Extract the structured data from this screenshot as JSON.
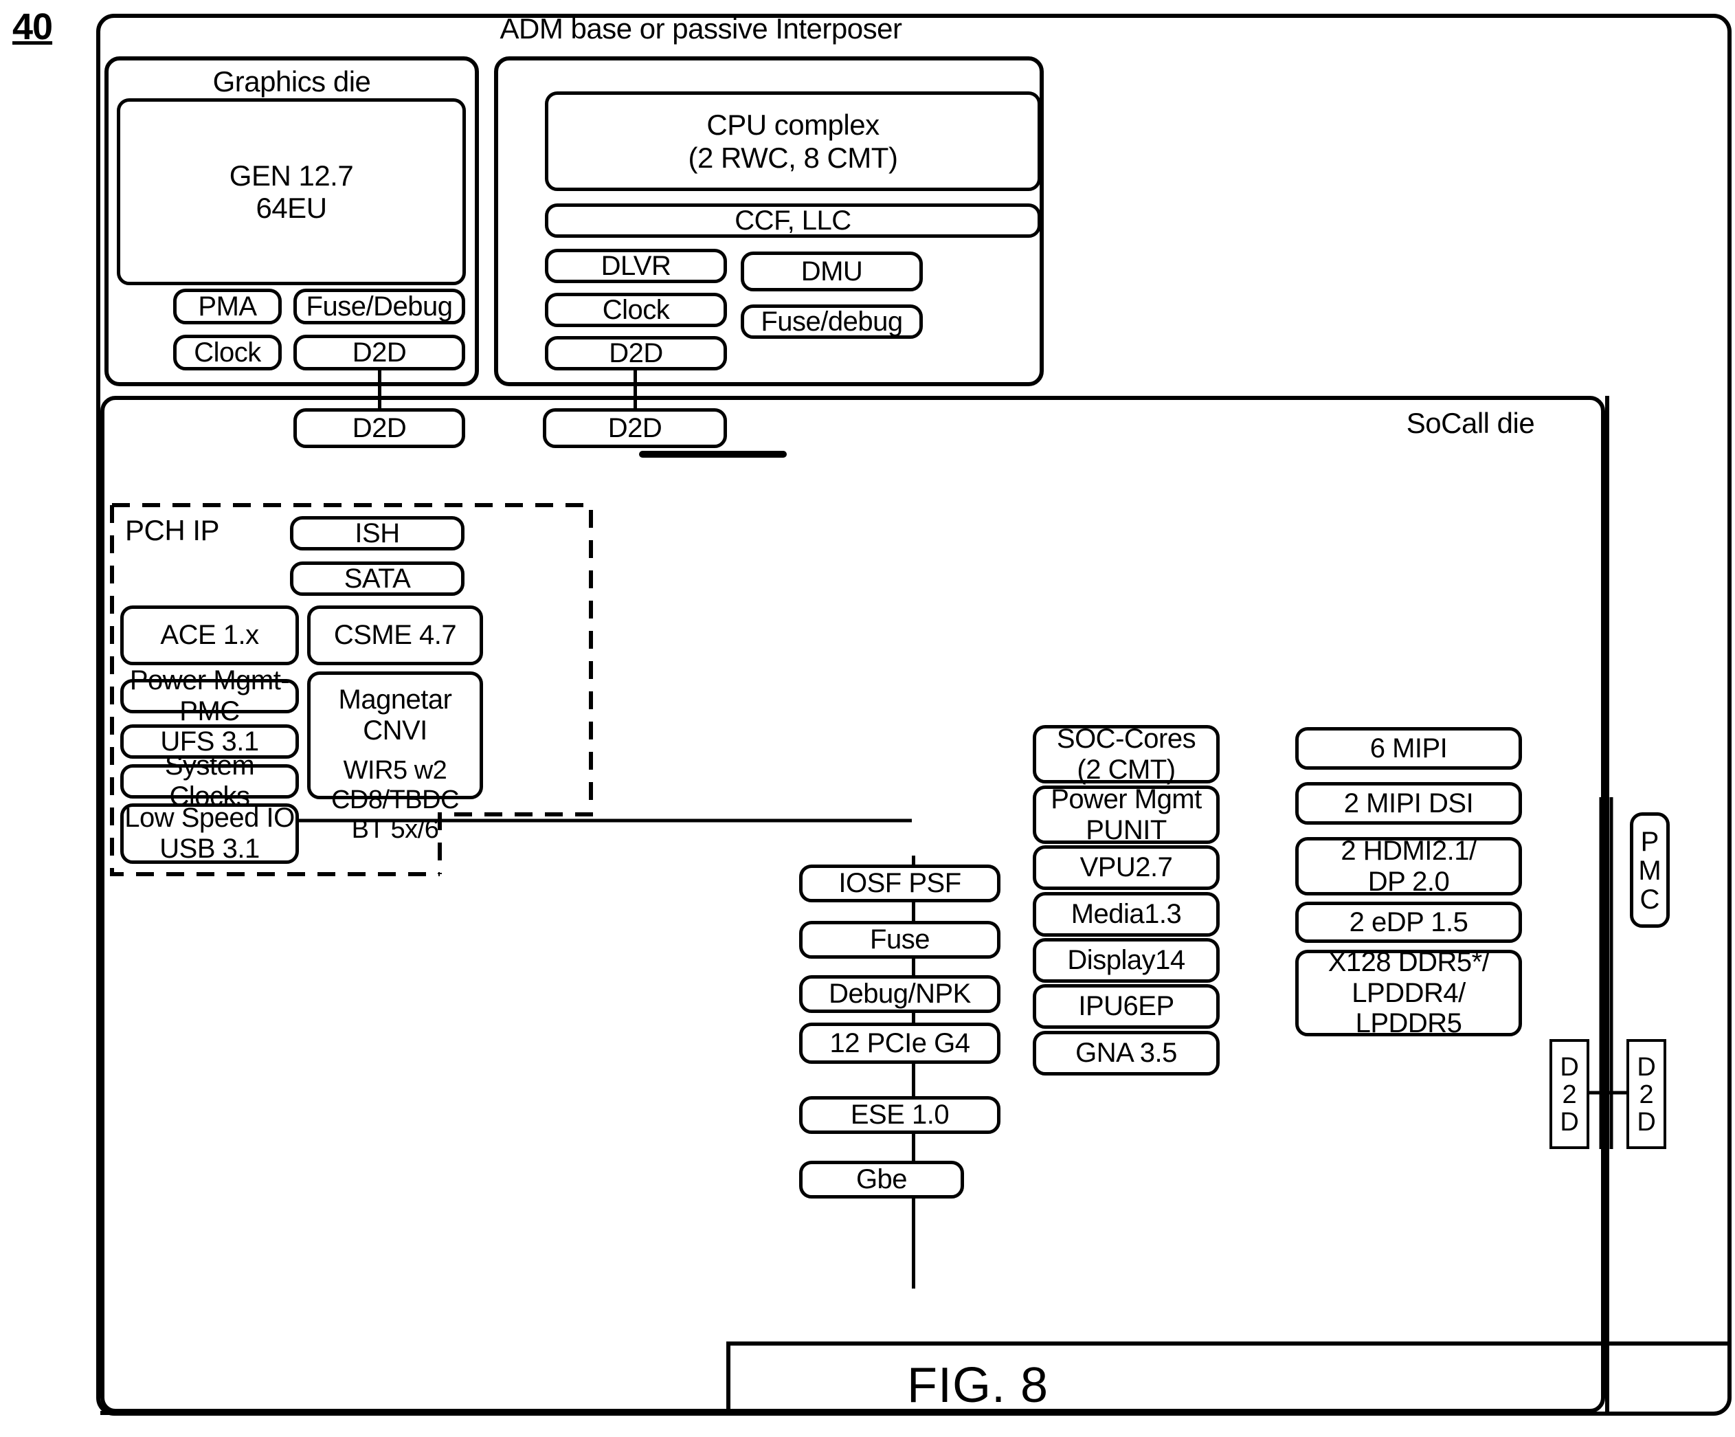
{
  "figure": {
    "reference_numeral": "40",
    "caption": "FIG. 8"
  },
  "interposer": {
    "label": "ADM base or passive Interposer"
  },
  "graphics_die": {
    "label": "Graphics die",
    "main_block": "GEN 12.7\n64EU",
    "blocks": [
      {
        "label": "PMA"
      },
      {
        "label": "Fuse/Debug"
      },
      {
        "label": "Clock"
      },
      {
        "label": "D2D"
      }
    ]
  },
  "cpu_die": {
    "blocks": [
      {
        "label": "CPU complex\n(2 RWC, 8 CMT)"
      },
      {
        "label": "CCF, LLC"
      },
      {
        "label": "DLVR"
      },
      {
        "label": "DMU"
      },
      {
        "label": "Clock"
      },
      {
        "label": "Fuse/debug"
      },
      {
        "label": "D2D"
      }
    ]
  },
  "interconnect": {
    "d2d_left": "D2D",
    "d2d_right": "D2D"
  },
  "soc_die": {
    "label": "SoCall die",
    "pch_ip": {
      "label": "PCH IP",
      "blocks": [
        {
          "label": "ISH"
        },
        {
          "label": "SATA"
        },
        {
          "label": "ACE 1.x"
        },
        {
          "label": "CSME 4.7"
        },
        {
          "label": "Power Mgmt-PMC"
        },
        {
          "label": "Magnetar CNVI",
          "detail": "WIR5 w2\nCD8/TBDC\nBT 5x/6"
        },
        {
          "label": "UFS 3.1"
        },
        {
          "label": "System Clocks"
        },
        {
          "label": "Low Speed IO\nUSB 3.1"
        }
      ]
    },
    "fabric_column": [
      {
        "label": "IOSF PSF"
      },
      {
        "label": "Fuse"
      },
      {
        "label": "Debug/NPK"
      },
      {
        "label": "12 PCIe G4"
      },
      {
        "label": "ESE 1.0"
      },
      {
        "label": "Gbe"
      }
    ],
    "core_column": [
      {
        "label": "SOC-Cores\n(2 CMT)"
      },
      {
        "label": "Power Mgmt\nPUNIT"
      },
      {
        "label": "VPU2.7"
      },
      {
        "label": "Media1.3"
      },
      {
        "label": "Display14"
      },
      {
        "label": "IPU6EP"
      },
      {
        "label": "GNA 3.5"
      }
    ],
    "io_column": [
      {
        "label": "6 MIPI"
      },
      {
        "label": "2 MIPI DSI"
      },
      {
        "label": "2 HDMI2.1/\nDP 2.0"
      },
      {
        "label": "2 eDP 1.5"
      },
      {
        "label": "X128 DDR5*/\nLPDDR4/\nLPDDR5"
      }
    ],
    "edge_blocks": [
      {
        "label": "PMC"
      },
      {
        "label": "D2D"
      },
      {
        "label": "D2D"
      }
    ]
  },
  "colors": {
    "line": "#000000",
    "background": "#ffffff"
  }
}
